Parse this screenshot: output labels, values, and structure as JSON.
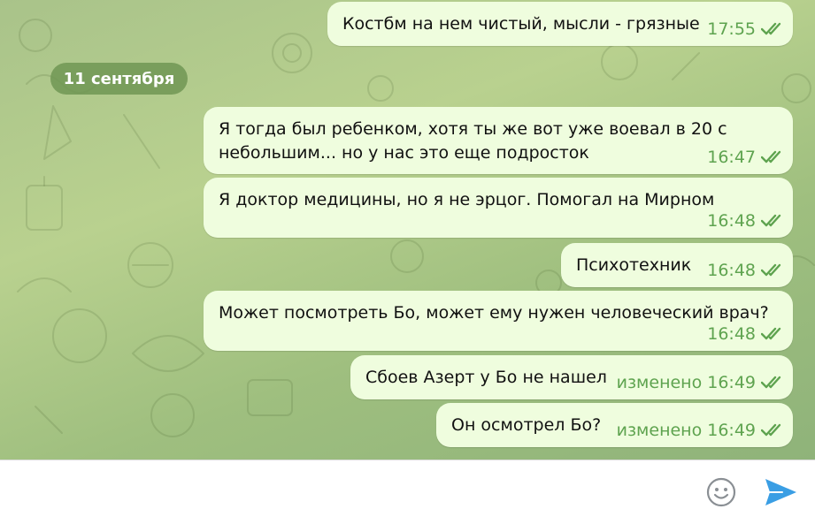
{
  "date_separator": "11 сентября",
  "messages": [
    {
      "text": "Костбм на нем чистый, мысли - грязные",
      "time": "17:55",
      "edited": ""
    },
    {
      "text": "Я тогда был ребенком, хотя ты же вот уже воевал в 20 с\nнебольшим... но у нас это еще подросток",
      "time": "16:47",
      "edited": ""
    },
    {
      "text": "Я доктор медицины, но я не эрцог. Помогал на Мирном",
      "time": "16:48",
      "edited": ""
    },
    {
      "text": "Психотехник",
      "time": "16:48",
      "edited": ""
    },
    {
      "text": "Может посмотреть Бо, может ему нужен человеческий врач?",
      "time": "16:48",
      "edited": ""
    },
    {
      "text": "Сбоев Азерт у Бо не нашел",
      "time": "16:49",
      "edited": "изменено"
    },
    {
      "text": "Он осмотрел Бо?",
      "time": "16:49",
      "edited": "изменено"
    }
  ],
  "composer": {
    "placeholder": "",
    "value": ""
  },
  "icons": {
    "emoji": "smile-icon",
    "send": "send-arrow-icon",
    "status": "double-check-icon"
  },
  "colors": {
    "bubble": "#effdde",
    "meta": "#5ea34f",
    "send": "#3a9ee4"
  }
}
